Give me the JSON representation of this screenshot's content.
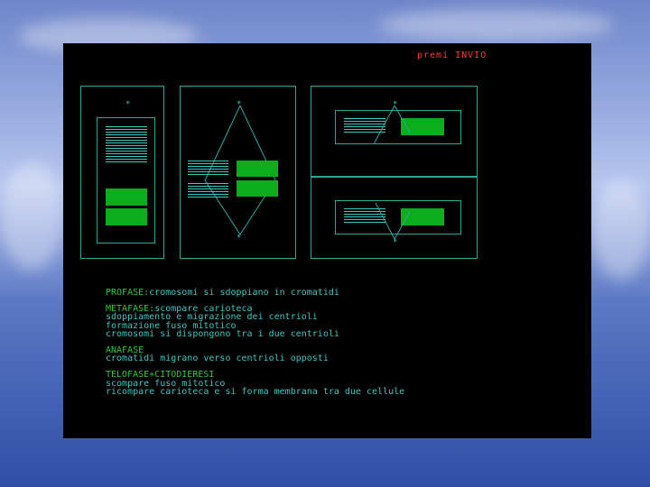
{
  "prompt": "premi INVIO",
  "phases": {
    "profase": {
      "title": "PROFASE:",
      "text": "cromosomi si sdoppiano in cromatidi"
    },
    "metafase": {
      "title": "METAFASE:",
      "line1": "scompare carioteca",
      "line2": "sdoppiamento e migrazione dei centrioli",
      "line3": "formazione fuso mitotico",
      "line4": "cromosomi si dispongono tra i due centrioli"
    },
    "anafase": {
      "title": "ANAFASE",
      "line1": "cromatidi migrano verso centrioli opposti"
    },
    "telofase": {
      "title": "TELOFASE+CITODIERESI",
      "line1": "scompare fuso mitotico",
      "line2": "ricompare carioteca e si forma membrana tra due cellule"
    }
  },
  "diagram": {
    "centriole_symbol": "*"
  },
  "colors": {
    "screen": "#000000",
    "prompt": "#ff3b3b",
    "title": "#2ec735",
    "text": "#3ec6c0",
    "chromosome": "#0cad1c"
  }
}
